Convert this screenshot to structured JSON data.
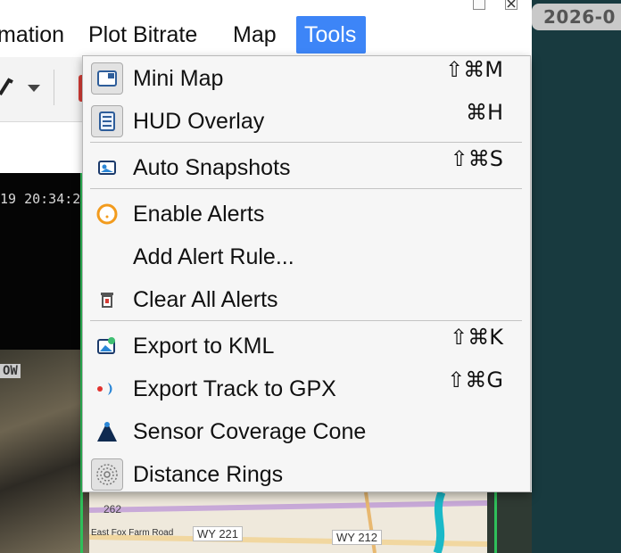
{
  "desktop": {
    "date": "2026-0"
  },
  "menubar": {
    "items": [
      {
        "label": "mation"
      },
      {
        "label": "Plot Bitrate"
      },
      {
        "label": "Map"
      },
      {
        "label": "Tools",
        "active": true
      }
    ]
  },
  "video": {
    "timestamp": "19 20:34:2",
    "overlay_tag": "OW"
  },
  "tools_menu": {
    "items": [
      {
        "label": "Mini Map",
        "shortcut": "⇧⌘M",
        "icon": "mini-map-icon"
      },
      {
        "label": "HUD Overlay",
        "shortcut": "⌘H",
        "icon": "hud-overlay-icon"
      },
      {
        "label": "Auto Snapshots",
        "shortcut": "⇧⌘S",
        "icon": "snapshot-icon"
      },
      {
        "label": "Enable Alerts",
        "shortcut": "",
        "icon": "alert-ring-icon"
      },
      {
        "label": "Add Alert Rule...",
        "shortcut": "",
        "icon": ""
      },
      {
        "label": "Clear All Alerts",
        "shortcut": "",
        "icon": "trash-icon"
      },
      {
        "label": "Export to KML",
        "shortcut": "⇧⌘K",
        "icon": "kml-export-icon"
      },
      {
        "label": "Export Track to GPX",
        "shortcut": "⇧⌘G",
        "icon": "gpx-track-icon"
      },
      {
        "label": "Sensor Coverage Cone",
        "shortcut": "",
        "icon": "cone-icon"
      },
      {
        "label": "Distance Rings",
        "shortcut": "",
        "icon": "distance-rings-icon"
      }
    ]
  },
  "map": {
    "labels": [
      "262",
      "East Fox Farm Road",
      "WY 221",
      "WY 212"
    ]
  },
  "colors": {
    "menu_highlight": "#3d85f7",
    "desktop_bg": "#183a3f",
    "alert_orange": "#f29b1d"
  }
}
